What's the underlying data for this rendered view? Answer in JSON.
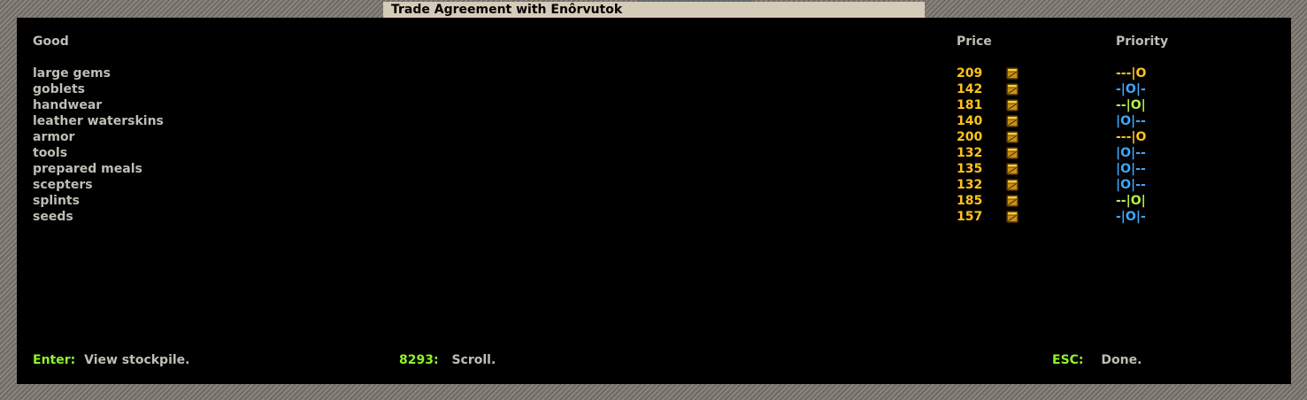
{
  "window": {
    "title": "Trade Agreement with Enôrvutok"
  },
  "columns": {
    "good": "Good",
    "price": "Price",
    "priority": "Priority"
  },
  "rows": [
    {
      "good": "large gems",
      "price": "209",
      "priority": "---|O",
      "priority_color": "#ffc31a"
    },
    {
      "good": "goblets",
      "price": "142",
      "priority": "-|O|-",
      "priority_color": "#3ea7ff"
    },
    {
      "good": "handwear",
      "price": "181",
      "priority": "--|O|",
      "priority_color": "#b4f040"
    },
    {
      "good": "leather waterskins",
      "price": "140",
      "priority": "|O|--",
      "priority_color": "#3ea7ff"
    },
    {
      "good": "armor",
      "price": "200",
      "priority": "---|O",
      "priority_color": "#ffc31a"
    },
    {
      "good": "tools",
      "price": "132",
      "priority": "|O|--",
      "priority_color": "#3ea7ff"
    },
    {
      "good": "prepared meals",
      "price": "135",
      "priority": "|O|--",
      "priority_color": "#3ea7ff"
    },
    {
      "good": "scepters",
      "price": "132",
      "priority": "|O|--",
      "priority_color": "#3ea7ff"
    },
    {
      "good": "splints",
      "price": "185",
      "priority": "--|O|",
      "priority_color": "#b4f040"
    },
    {
      "good": "seeds",
      "price": "157",
      "priority": "-|O|-",
      "priority_color": "#3ea7ff"
    }
  ],
  "icons": {
    "price_icon": "coin-icon"
  },
  "footer": {
    "enter_key": "Enter",
    "enter_sep": ":",
    "enter_desc": "View stockpile.",
    "scroll_key": "8293",
    "scroll_sep": ":",
    "scroll_desc": "Scroll.",
    "esc_key": "ESC",
    "esc_sep": ":",
    "esc_desc": "Done."
  },
  "colors": {
    "price": "#ffc31a",
    "key": "#8ef32a",
    "text": "#c0bdb5",
    "panel": "#000000",
    "title_bar": "#d4cbb8"
  }
}
